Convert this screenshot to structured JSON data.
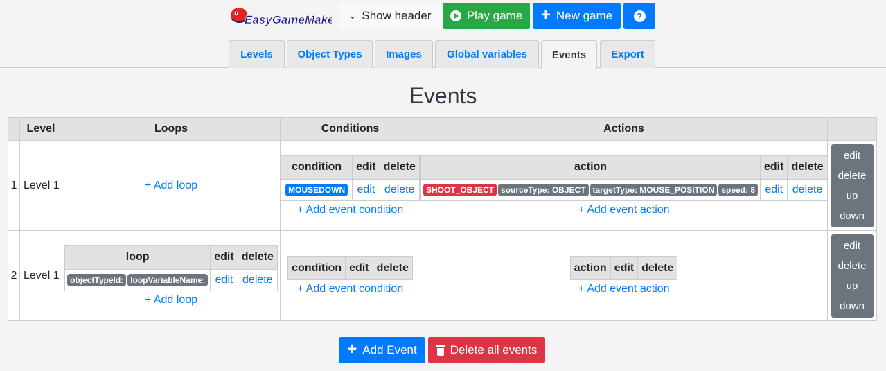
{
  "header": {
    "logo_text": "EasyGameMaker",
    "show_header_label": "Show header",
    "play_game_label": "Play game",
    "new_game_label": "New game",
    "help_label": "?"
  },
  "tabs": [
    "Levels",
    "Object Types",
    "Images",
    "Global variables",
    "Events",
    "Export"
  ],
  "active_tab": "Events",
  "page_title": "Events",
  "table": {
    "headers": [
      "",
      "Level",
      "Loops",
      "Conditions",
      "Actions",
      ""
    ],
    "rows": [
      {
        "index": "1",
        "level": "Level 1",
        "add_loop": "+ Add loop",
        "condition_headers": [
          "condition",
          "edit",
          "delete"
        ],
        "conditions": [
          {
            "badge": "MOUSEDOWN",
            "edit": "edit",
            "delete": "delete"
          }
        ],
        "add_condition": "+ Add event condition",
        "action_headers": [
          "action",
          "edit",
          "delete"
        ],
        "actions": [
          {
            "badges": [
              "SHOOT_OBJECT",
              "sourceType: OBJECT",
              "targetType: MOUSE_POSITION",
              "speed: 8"
            ],
            "edit": "edit",
            "delete": "delete"
          }
        ],
        "add_action": "+ Add event action",
        "side": [
          "edit",
          "delete",
          "up",
          "down"
        ]
      },
      {
        "index": "2",
        "level": "Level 1",
        "loop_headers": [
          "loop",
          "edit",
          "delete"
        ],
        "loops": [
          {
            "badges": [
              "objectTypeId:",
              "loopVariableName:"
            ],
            "edit": "edit",
            "delete": "delete"
          }
        ],
        "add_loop": "+ Add loop",
        "condition_headers": [
          "condition",
          "edit",
          "delete"
        ],
        "add_condition": "+ Add event condition",
        "action_headers": [
          "action",
          "edit",
          "delete"
        ],
        "add_action": "+ Add event action",
        "side": [
          "edit",
          "delete",
          "up",
          "down"
        ]
      }
    ]
  },
  "footer": {
    "add_event_label": "Add Event",
    "delete_all_label": "Delete all events"
  },
  "colors": {
    "primary": "#007bff",
    "success": "#28a745",
    "danger": "#dc3545",
    "secondary": "#6c757d"
  }
}
